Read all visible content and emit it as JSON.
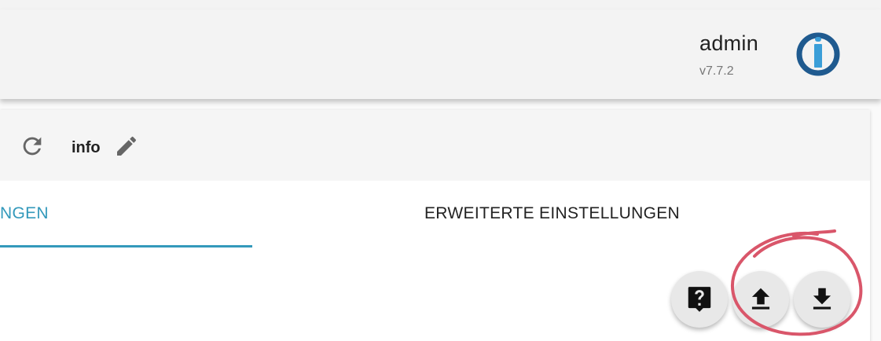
{
  "header": {
    "user_name": "admin",
    "version": "v7.7.2",
    "logo_icon": "iobroker-logo-icon"
  },
  "toolbar": {
    "refresh_icon": "refresh-icon",
    "instance_label": "info",
    "edit_icon": "edit-pencil-icon"
  },
  "tabs": [
    {
      "label": "NGEN",
      "active": true
    },
    {
      "label": "ERWEITERTE EINSTELLUNGEN",
      "active": false
    }
  ],
  "fabs": [
    {
      "name": "help",
      "icon": "help-icon"
    },
    {
      "name": "upload",
      "icon": "upload-icon"
    },
    {
      "name": "download",
      "icon": "download-icon"
    }
  ],
  "colors": {
    "accent": "#3399bb",
    "logo_blue": "#1f5a8f",
    "annotation_red": "#d9566a"
  }
}
